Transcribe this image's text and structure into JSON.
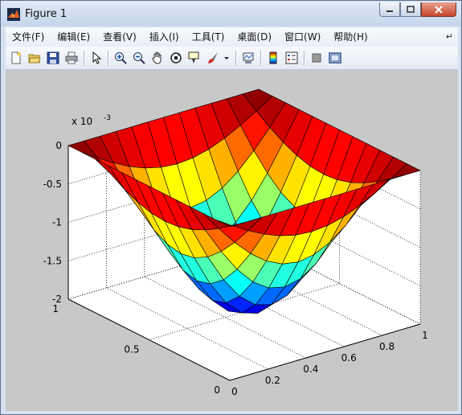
{
  "window": {
    "title": "Figure 1",
    "icon": "matlab-icon"
  },
  "menubar": {
    "items": [
      "文件(F)",
      "编辑(E)",
      "查看(V)",
      "插入(I)",
      "工具(T)",
      "桌面(D)",
      "窗口(W)",
      "帮助(H)"
    ],
    "overflow_icon": "chevron-double-icon"
  },
  "toolbar": {
    "buttons": [
      "new-figure-icon",
      "open-file-icon",
      "save-icon",
      "print-icon",
      "edit-plot-arrow-icon",
      "zoom-in-icon",
      "zoom-out-icon",
      "pan-hand-icon",
      "rotate-3d-icon",
      "data-cursor-icon",
      "brush-icon",
      "brush-dropdown-icon",
      "link-plot-icon",
      "colorbar-icon",
      "legend-icon",
      "hide-plot-tools-icon",
      "show-plot-tools-icon"
    ]
  },
  "plot": {
    "type": "3d-surface",
    "z_exponent_label": "x 10",
    "z_exponent": "-3",
    "z_ticks": [
      "0",
      "-0.5",
      "-1",
      "-1.5",
      "-2"
    ],
    "y_ticks": [
      "0",
      "0.5",
      "1"
    ],
    "x_ticks": [
      "0",
      "0.2",
      "0.4",
      "0.6",
      "0.8",
      "1"
    ],
    "colormap": "jet",
    "grid": true
  },
  "chart_data": {
    "type": "surface",
    "title": "",
    "xlabel": "",
    "ylabel": "",
    "zlabel": "",
    "xlim": [
      0,
      1
    ],
    "ylim": [
      0,
      1
    ],
    "zlim": [
      -0.002,
      0
    ],
    "z_scale": "x 10^-3",
    "grid": true,
    "description_of_surface": "z(x,y) ~ -0.002*sin(pi*x)*sin(pi*y) on [0,1]x[0,1], 13x13 mesh"
  },
  "colors": {
    "figure_bg": "#c8c8c8",
    "axes_bg": "#ffffff"
  }
}
